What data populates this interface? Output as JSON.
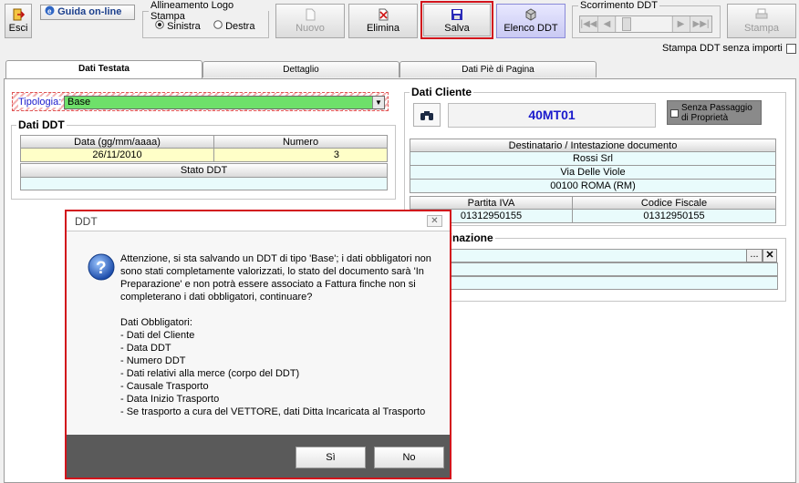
{
  "toolbar": {
    "esci": "Esci",
    "guida": "Guida on-line",
    "logo_group_title": "Allineamento Logo Stampa",
    "radio_sinistra": "Sinistra",
    "radio_destra": "Destra",
    "nuovo": "Nuovo",
    "elimina": "Elimina",
    "salva": "Salva",
    "elenco": "Elenco DDT",
    "scroll_group_title": "Scorrimento DDT",
    "stampa": "Stampa",
    "stampa_senza_importi": "Stampa DDT senza importi"
  },
  "tabs": [
    "Dati Testata",
    "Dettaglio",
    "Dati Piè di Pagina"
  ],
  "testata": {
    "tipologia_label": "Tipologia:",
    "tipologia_value": "Base",
    "dati_ddt_title": "Dati DDT",
    "col_data": "Data (gg/mm/aaaa)",
    "col_numero": "Numero",
    "data_value": "26/11/2010",
    "numero_value": "3",
    "stato_label": "Stato DDT",
    "stato_value": ""
  },
  "cliente": {
    "title": "Dati Cliente",
    "code": "40MT01",
    "senza_passaggio": "Senza Passaggio di Proprietà",
    "dest_header": "Destinatario / Intestazione documento",
    "name": "Rossi Srl",
    "street": "Via Delle Viole",
    "city": "00100  ROMA (RM)",
    "piva_label": "Partita IVA",
    "cf_label": "Codice Fiscale",
    "piva": "01312950155",
    "cf": "01312950155"
  },
  "destinazione": {
    "title_partial": "stinazione"
  },
  "dialog": {
    "title": "DDT",
    "message": "Attenzione, si sta salvando un DDT di tipo 'Base'; i dati obbligatori non\nsono stati completamente valorizzati, lo stato del documento sarà 'In\nPreparazione' e non potrà essere associato a Fattura finche non si\ncompleterano i dati obbligatori, continuare?\n\nDati Obbligatori:\n- Dati del Cliente\n- Data DDT\n- Numero DDT\n- Dati relativi alla merce (corpo del DDT)\n- Causale Trasporto\n- Data Inizio Trasporto\n- Se trasporto a cura del VETTORE, dati Ditta Incaricata al Trasporto",
    "yes": "Sì",
    "no": "No"
  },
  "colors": {
    "highlight": "#d2141c",
    "code_blue": "#1a1acc",
    "dialog_footer": "#5a5a5a"
  }
}
